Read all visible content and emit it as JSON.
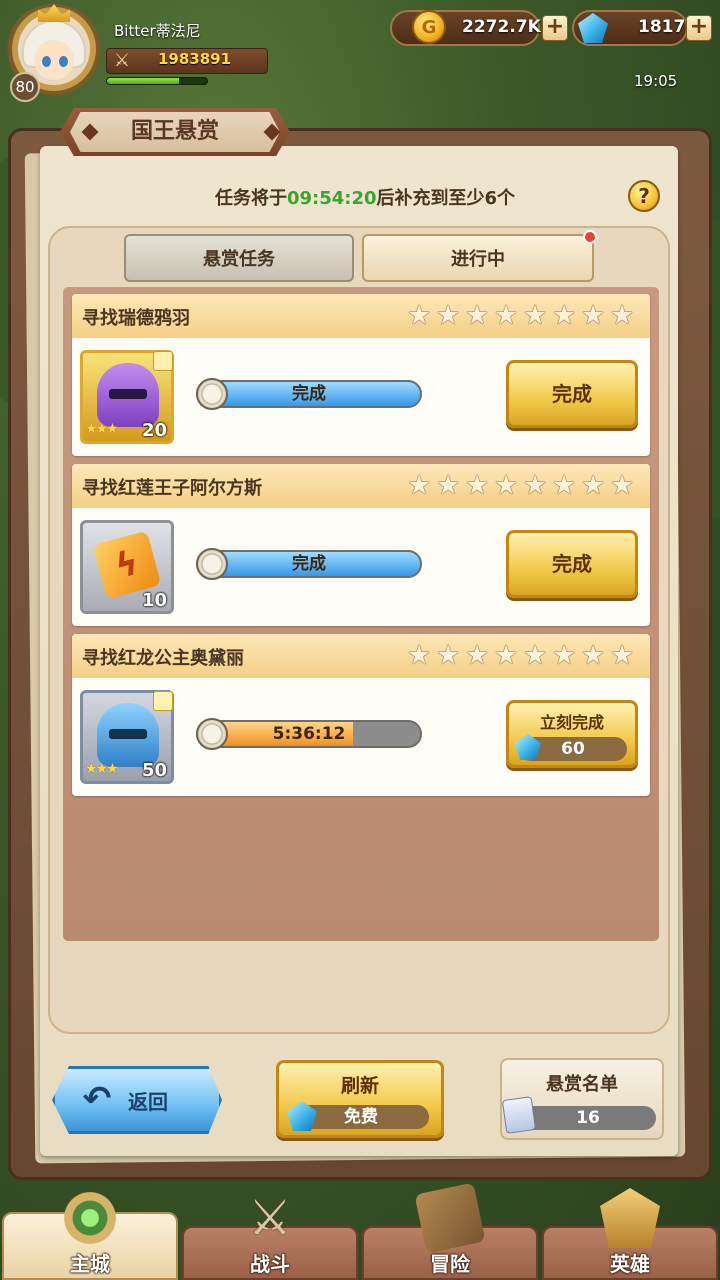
{
  "player": {
    "name": "Bitter蒂法尼",
    "level": "80",
    "power": "1983891",
    "exp_fraction": 0.72
  },
  "currency": {
    "gold": "2272.7K",
    "diamonds": "1817"
  },
  "clock": "19:05",
  "panel": {
    "title": "国王悬赏",
    "timer_prefix": "任务将于",
    "timer_time": "09:54:20",
    "timer_suffix": "后补充到至少6个",
    "help": "?"
  },
  "tabs": [
    {
      "label": "悬赏任务",
      "active": false
    },
    {
      "label": "进行中",
      "active": true
    }
  ],
  "tasks": [
    {
      "title": "寻找瑞德鸦羽",
      "stars": 8,
      "item": {
        "icon": "purple-helmet-icon",
        "quantity": "20",
        "rarity_stars": 3
      },
      "progress_text": "完成",
      "progress": 1.0,
      "button_label": "完成"
    },
    {
      "title": "寻找红莲王子阿尔方斯",
      "stars": 8,
      "item": {
        "icon": "lightning-rune-icon",
        "quantity": "10",
        "rarity_stars": 0
      },
      "progress_text": "完成",
      "progress": 1.0,
      "button_label": "完成"
    },
    {
      "title": "寻找红龙公主奥黛丽",
      "stars": 8,
      "item": {
        "icon": "blue-helmet-icon",
        "quantity": "50",
        "rarity_stars": 3
      },
      "progress_text": "5:36:12",
      "progress": 0.7,
      "button_label": "立刻完成",
      "button_cost": "60"
    }
  ],
  "bottom": {
    "back_label": "返回",
    "refresh_label": "刷新",
    "refresh_cost": "免费",
    "list_label": "悬赏名单",
    "list_count": "16"
  },
  "nav": [
    {
      "label": "主城",
      "icon": "city-icon",
      "active": true
    },
    {
      "label": "战斗",
      "icon": "crossed-swords-icon",
      "active": false
    },
    {
      "label": "冒险",
      "icon": "map-icon",
      "active": false
    },
    {
      "label": "英雄",
      "icon": "hero-shield-icon",
      "active": false
    }
  ],
  "colors": {
    "timer_green": "#3aa52b",
    "gold_button": "#f2c94a",
    "blue_progress": "#3598e8",
    "orange_progress": "#f0921e"
  }
}
